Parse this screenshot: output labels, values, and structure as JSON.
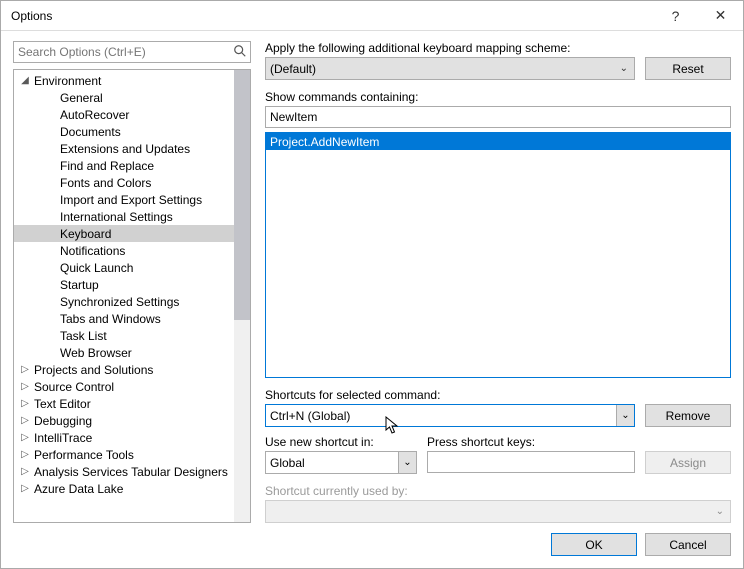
{
  "window": {
    "title": "Options"
  },
  "search": {
    "placeholder": "Search Options (Ctrl+E)"
  },
  "tree": {
    "nodes": [
      {
        "label": "Environment",
        "depth": 1,
        "expanded": true
      },
      {
        "label": "General",
        "depth": 2
      },
      {
        "label": "AutoRecover",
        "depth": 2
      },
      {
        "label": "Documents",
        "depth": 2
      },
      {
        "label": "Extensions and Updates",
        "depth": 2
      },
      {
        "label": "Find and Replace",
        "depth": 2
      },
      {
        "label": "Fonts and Colors",
        "depth": 2
      },
      {
        "label": "Import and Export Settings",
        "depth": 2
      },
      {
        "label": "International Settings",
        "depth": 2
      },
      {
        "label": "Keyboard",
        "depth": 2,
        "selected": true
      },
      {
        "label": "Notifications",
        "depth": 2
      },
      {
        "label": "Quick Launch",
        "depth": 2
      },
      {
        "label": "Startup",
        "depth": 2
      },
      {
        "label": "Synchronized Settings",
        "depth": 2
      },
      {
        "label": "Tabs and Windows",
        "depth": 2
      },
      {
        "label": "Task List",
        "depth": 2
      },
      {
        "label": "Web Browser",
        "depth": 2
      },
      {
        "label": "Projects and Solutions",
        "depth": 1,
        "expanded": false
      },
      {
        "label": "Source Control",
        "depth": 1,
        "expanded": false
      },
      {
        "label": "Text Editor",
        "depth": 1,
        "expanded": false
      },
      {
        "label": "Debugging",
        "depth": 1,
        "expanded": false
      },
      {
        "label": "IntelliTrace",
        "depth": 1,
        "expanded": false
      },
      {
        "label": "Performance Tools",
        "depth": 1,
        "expanded": false
      },
      {
        "label": "Analysis Services Tabular Designers",
        "depth": 1,
        "expanded": false
      },
      {
        "label": "Azure Data Lake",
        "depth": 1,
        "expanded": false
      }
    ]
  },
  "labels": {
    "scheme": "Apply the following additional keyboard mapping scheme:",
    "show_cmds": "Show commands containing:",
    "shortcuts_for": "Shortcuts for selected command:",
    "use_new": "Use new shortcut in:",
    "press_keys": "Press shortcut keys:",
    "currently_used": "Shortcut currently used by:"
  },
  "values": {
    "scheme": "(Default)",
    "filter": "NewItem",
    "command_selected": "Project.AddNewItem",
    "shortcut_selected": "Ctrl+N (Global)",
    "scope": "Global",
    "press_keys_value": ""
  },
  "buttons": {
    "reset": "Reset",
    "remove": "Remove",
    "assign": "Assign",
    "ok": "OK",
    "cancel": "Cancel"
  }
}
